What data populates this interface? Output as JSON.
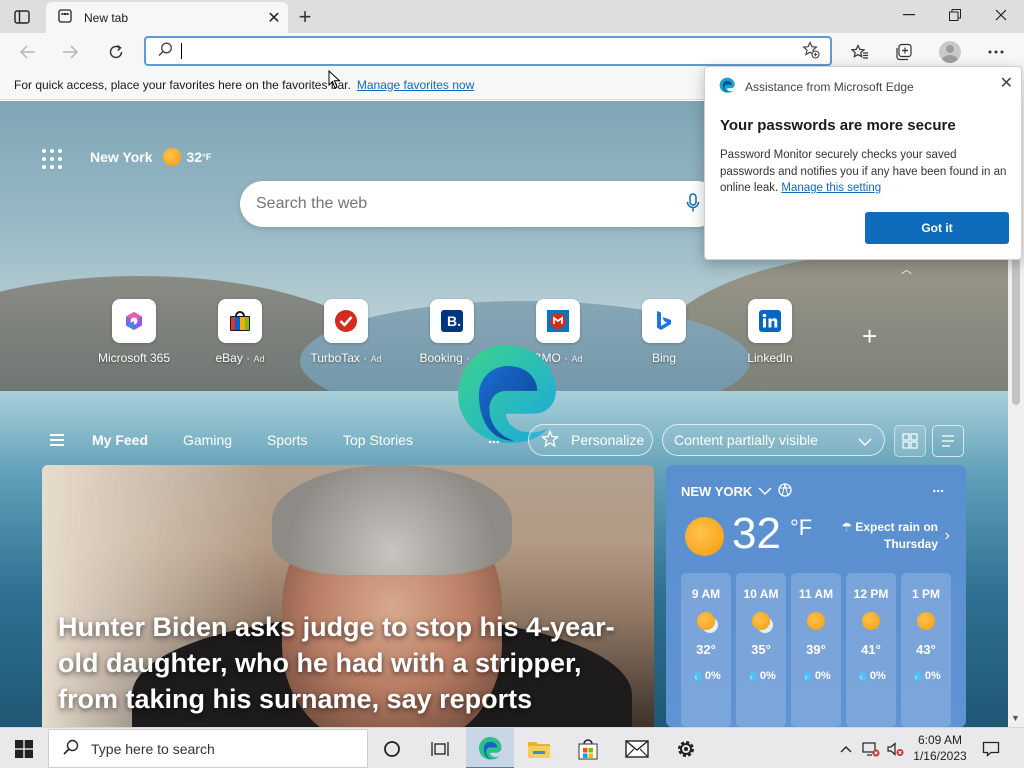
{
  "browser": {
    "tab_title": "New tab",
    "address_value": "",
    "favorites_hint": "For quick access, place your favorites here on the favorites bar.",
    "favorites_link": "Manage favorites now"
  },
  "newtab": {
    "city": "New York",
    "temp": "32",
    "temp_unit": "°F",
    "search_placeholder": "Search the web",
    "quick_links": [
      {
        "name": "Microsoft 365",
        "ad": ""
      },
      {
        "name": "eBay",
        "ad": "Ad"
      },
      {
        "name": "TurboTax",
        "ad": "Ad"
      },
      {
        "name": "Booking",
        "ad": "Ad"
      },
      {
        "name": "BMO",
        "ad": "Ad"
      },
      {
        "name": "Bing",
        "ad": ""
      },
      {
        "name": "LinkedIn",
        "ad": ""
      }
    ],
    "feed_tabs": [
      "My Feed",
      "Gaming",
      "Sports",
      "Top Stories"
    ],
    "feed_more": "...",
    "personalize": "Personalize",
    "content_visibility": "Content partially visible",
    "headline": "Hunter Biden asks judge to stop his 4-year-old daughter, who he had with a stripper, from taking his surname, say reports"
  },
  "weather_card": {
    "location": "NEW YORK",
    "more": "...",
    "temp": "32",
    "unit": "°F",
    "forecast": "Expect rain on Thursday",
    "hours": [
      {
        "time": "9 AM",
        "temp": "32°",
        "precip": "0%"
      },
      {
        "time": "10 AM",
        "temp": "35°",
        "precip": "0%"
      },
      {
        "time": "11 AM",
        "temp": "39°",
        "precip": "0%"
      },
      {
        "time": "12 PM",
        "temp": "41°",
        "precip": "0%"
      },
      {
        "time": "1 PM",
        "temp": "43°",
        "precip": "0%"
      }
    ]
  },
  "popup": {
    "source": "Assistance from Microsoft Edge",
    "title": "Your passwords are more secure",
    "body": "Password Monitor securely checks your saved passwords and notifies you if any have been found in an online leak.",
    "link": "Manage this setting",
    "button": "Got it"
  },
  "taskbar": {
    "search_placeholder": "Type here to search",
    "time": "6:09 AM",
    "date": "1/16/2023"
  },
  "colors": {
    "accent": "#0f6cbd",
    "weather_card": "#5a8fd0"
  }
}
